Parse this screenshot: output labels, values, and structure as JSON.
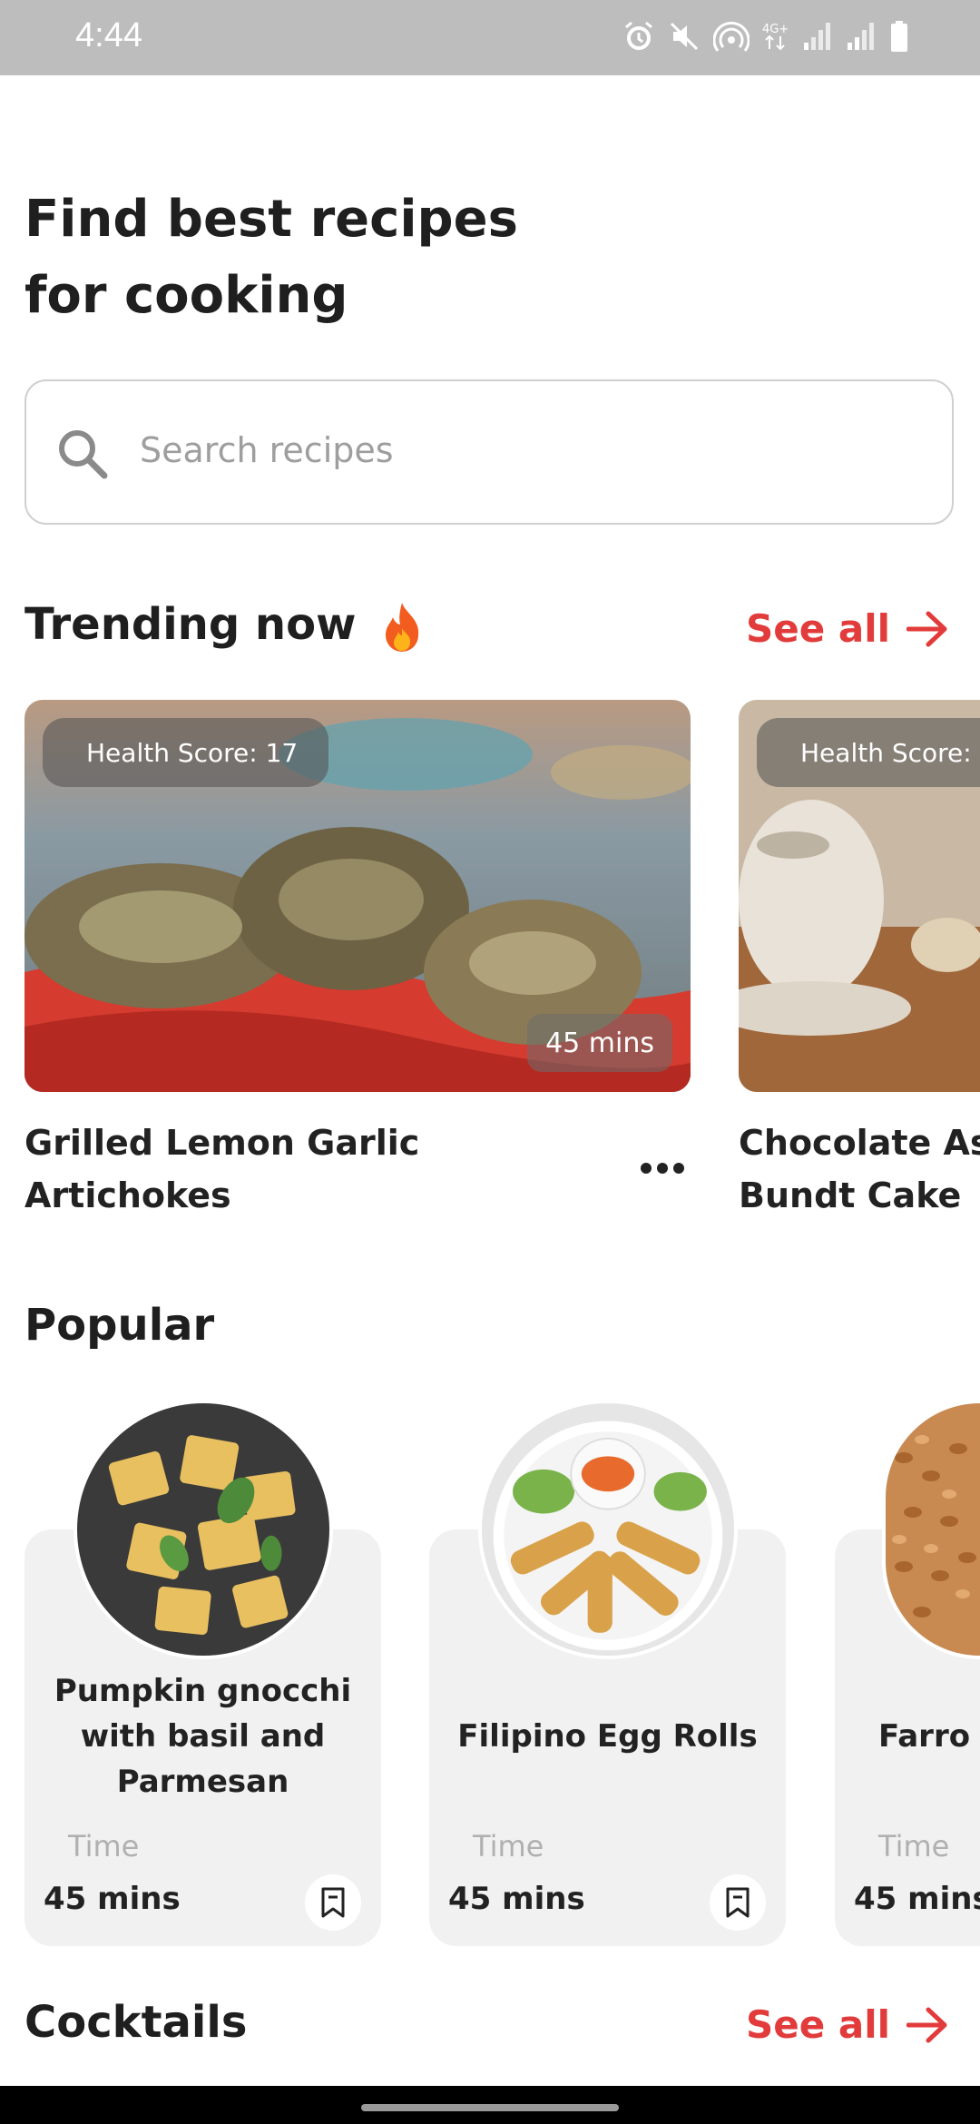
{
  "status_bar": {
    "time": "4:44",
    "icons": [
      "alarm-icon",
      "mute-icon",
      "hotspot-icon",
      "4g-icon",
      "signal-icon",
      "signal-icon",
      "battery-icon"
    ]
  },
  "header": {
    "title_line1": "Find best recipes",
    "title_line2": "for cooking"
  },
  "search": {
    "placeholder": "Search recipes",
    "icon": "search-icon"
  },
  "trending": {
    "title": "Trending now",
    "see_all": "See all",
    "cards": [
      {
        "health": "Health Score: 17",
        "time": "45 mins",
        "name_line1": "Grilled Lemon Garlic",
        "name_line2": "Artichokes"
      },
      {
        "health": "Health Score:",
        "name_line1": "Chocolate Asp",
        "name_line2": "Bundt Cake"
      }
    ]
  },
  "popular": {
    "title": "Popular",
    "cards": [
      {
        "name": "Pumpkin gnocchi with basil and Parmesan",
        "time_label": "Time",
        "time": "45 mins"
      },
      {
        "name": "Filipino Egg Rolls",
        "time_label": "Time",
        "time": "45 mins"
      },
      {
        "name": "Farro &",
        "time_label": "Time",
        "time": "45 mins"
      }
    ]
  },
  "cocktails": {
    "title": "Cocktails",
    "see_all": "See all"
  },
  "colors": {
    "accent": "#e23b3b",
    "text": "#1f1f1f",
    "card_bg": "#f1f1f1"
  }
}
